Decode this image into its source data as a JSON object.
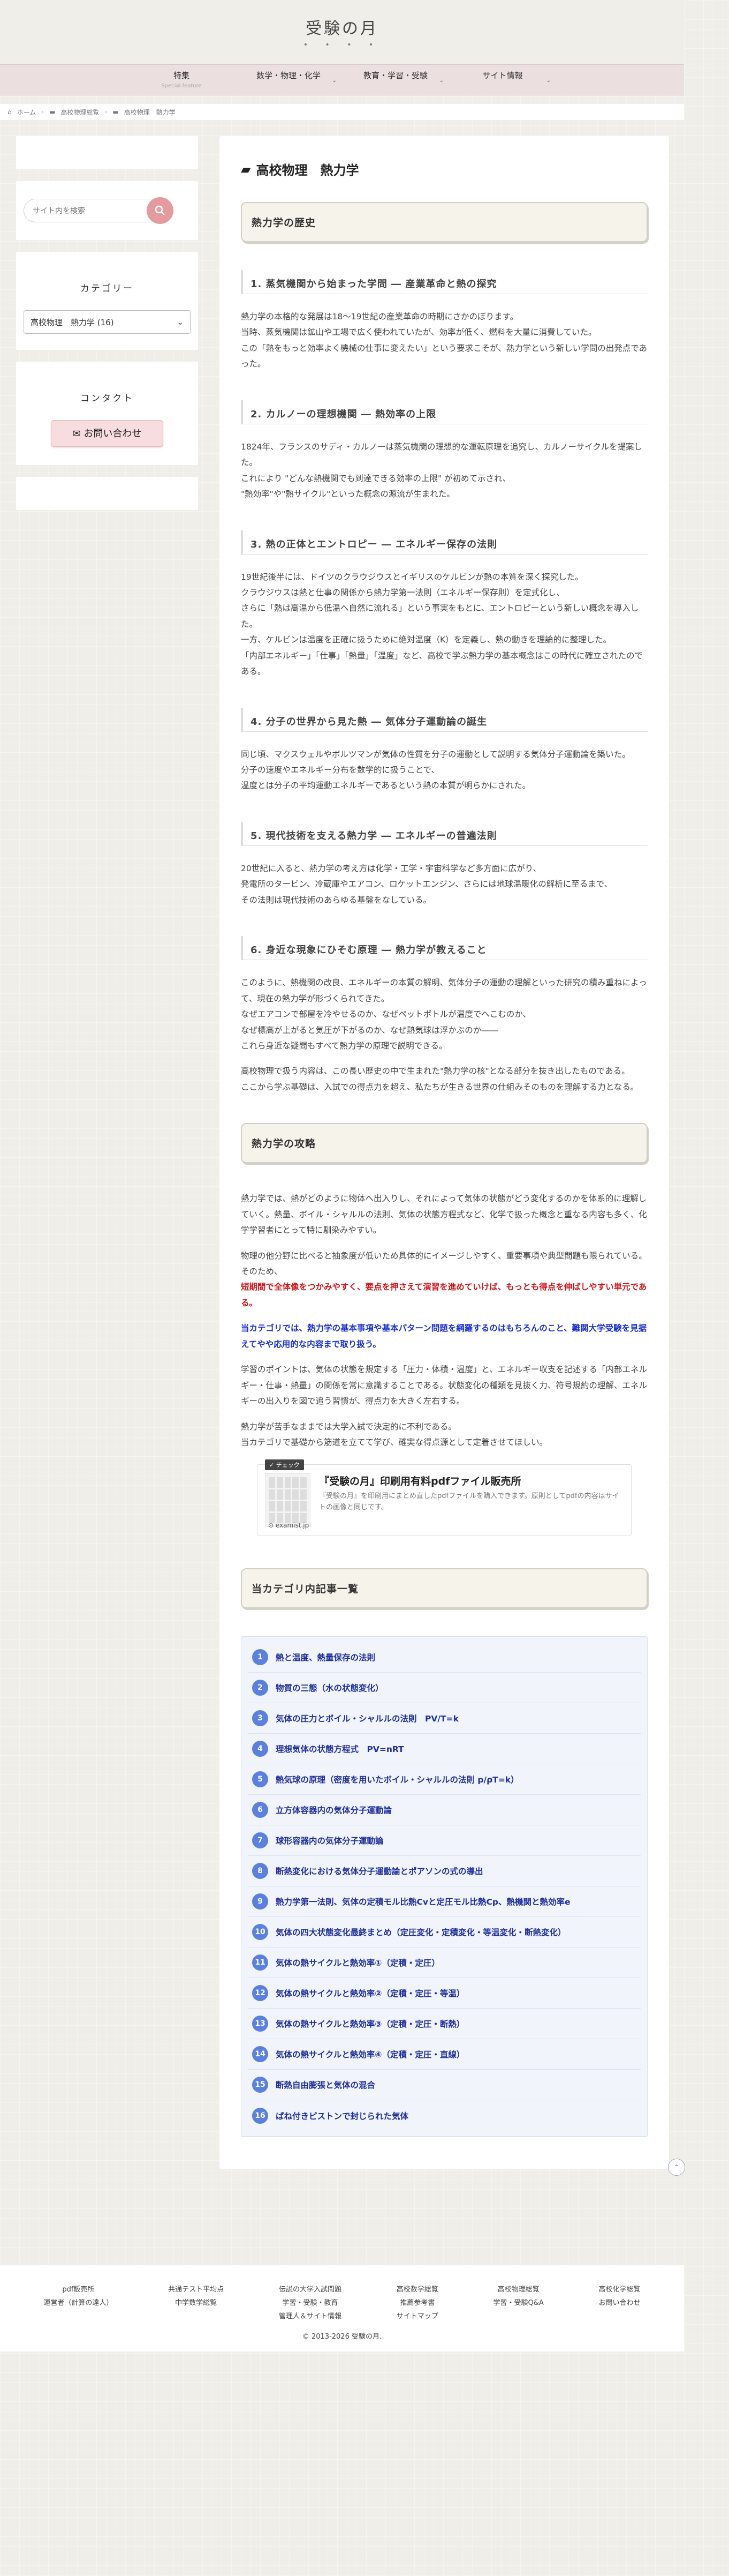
{
  "site": {
    "title": "受験の月",
    "dots": "• • • •"
  },
  "nav": [
    {
      "label": "特集",
      "sub": "Special feature",
      "caret": ""
    },
    {
      "label": "数学・物理・化学",
      "sub": "",
      "caret": "⌄"
    },
    {
      "label": "教育・学習・受験",
      "sub": "",
      "caret": "⌄"
    },
    {
      "label": "サイト情報",
      "sub": "",
      "caret": "⌄"
    }
  ],
  "breadcrumb": [
    "ホーム",
    "高校物理総覧",
    "高校物理　熱力学"
  ],
  "sidebar": {
    "search_placeholder": "サイト内を検索",
    "category_title": "カテゴリー",
    "category_value": "高校物理　熱力学 (16)",
    "contact_title": "コンタクト",
    "contact_button": "お問い合わせ"
  },
  "main": {
    "page_title": "高校物理　熱力学",
    "history_heading": "熱力学の歴史",
    "sections": [
      {
        "heading": "1. 蒸気機関から始まった学問 ― 産業革命と熱の探究",
        "paras": [
          "熱力学の本格的な発展は18～19世紀の産業革命の時期にさかのぼります。",
          "当時、蒸気機関は鉱山や工場で広く使われていたが、効率が低く、燃料を大量に消費していた。",
          "この「熱をもっと効率よく機械の仕事に変えたい」という要求こそが、熱力学という新しい学問の出発点であった。"
        ]
      },
      {
        "heading": "2. カルノーの理想機関 ― 熱効率の上限",
        "paras": [
          "1824年、フランスのサディ・カルノーは蒸気機関の理想的な運転原理を追究し、カルノーサイクルを提案した。",
          "これにより \"どんな熱機関でも到達できる効率の上限\" が初めて示され、",
          "\"熱効率\"や\"熱サイクル\"といった概念の源流が生まれた。"
        ]
      },
      {
        "heading": "3. 熱の正体とエントロピー ― エネルギー保存の法則",
        "paras": [
          "19世紀後半には、ドイツのクラウジウスとイギリスのケルビンが熱の本質を深く探究した。",
          "クラウジウスは熱と仕事の関係から熱力学第一法則（エネルギー保存則）を定式化し、",
          "さらに「熱は高温から低温へ自然に流れる」という事実をもとに、エントロピーという新しい概念を導入した。",
          "一方、ケルビンは温度を正確に扱うために絶対温度（K）を定義し、熱の動きを理論的に整理した。",
          "「内部エネルギー」「仕事」「熱量」「温度」など、高校で学ぶ熱力学の基本概念はこの時代に確立されたのである。"
        ]
      },
      {
        "heading": "4. 分子の世界から見た熱 ― 気体分子運動論の誕生",
        "paras": [
          "同じ頃、マクスウェルやボルツマンが気体の性質を分子の運動として説明する気体分子運動論を築いた。",
          "分子の速度やエネルギー分布を数学的に扱うことで、",
          "温度とは分子の平均運動エネルギーであるという熱の本質が明らかにされた。"
        ]
      },
      {
        "heading": "5. 現代技術を支える熱力学 ― エネルギーの普遍法則",
        "paras": [
          "20世紀に入ると、熱力学の考え方は化学・工学・宇宙科学など多方面に広がり、",
          "発電所のタービン、冷蔵庫やエアコン、ロケットエンジン、さらには地球温暖化の解析に至るまで、",
          "その法則は現代技術のあらゆる基盤をなしている。"
        ]
      },
      {
        "heading": "6. 身近な現象にひそむ原理 ― 熱力学が教えること",
        "paras": [
          "このように、熱機関の改良、エネルギーの本質の解明、気体分子の運動の理解といった研究の積み重ねによって、現在の熱力学が形づくられてきた。",
          "なぜエアコンで部屋を冷やせるのか、なぜペットボトルが温度でへこむのか、",
          "なぜ標高が上がると気圧が下がるのか、なぜ熱気球は浮かぶのか――",
          "これら身近な疑問もすべて熱力学の原理で説明できる。",
          "高校物理で扱う内容は、この長い歴史の中で生まれた\"熱力学の核\"となる部分を抜き出したものである。",
          "ここから学ぶ基礎は、入試での得点力を超え、私たちが生きる世界の仕組みそのものを理解する力となる。"
        ]
      }
    ],
    "strategy_heading": "熱力学の攻略",
    "strategy_paras": [
      "熱力学では、熱がどのように物体へ出入りし、それによって気体の状態がどう変化するのかを体系的に理解していく。熱量、ボイル・シャルルの法則、気体の状態方程式など、化学で扱った概念と重なる内容も多く、化学学習者にとって特に馴染みやすい。",
      "物理の他分野に比べると抽象度が低いため具体的にイメージしやすく、重要事項や典型問題も限られている。そのため、"
    ],
    "strategy_red": "短期間で全体像をつかみやすく、要点を押さえて演習を進めていけば、もっとも得点を伸ばしやすい単元である。",
    "strategy_blue": "当カテゴリでは、熱力学の基本事項や基本パターン問題を網羅するのはもちろんのこと、難関大学受験を見据えてやや応用的な内容まで取り扱う。",
    "strategy_paras2": [
      "学習のポイントは、気体の状態を規定する「圧力・体積・温度」と、エネルギー収支を記述する「内部エネルギー・仕事・熱量」の関係を常に意識することである。状態変化の種類を見抜く力、符号規約の理解、エネルギーの出入りを図で追う習慣が、得点力を大きく左右する。",
      "熱力学が苦手なままでは大学入試で決定的に不利である。",
      "当カテゴリで基礎から筋道を立てて学び、確実な得点源として定着させてほしい。"
    ],
    "card": {
      "tag": "✓ チェック",
      "title": "『受験の月』印刷用有料pdfファイル販売所",
      "desc": "『受験の月』を印刷用にまとめ直したpdfファイルを購入できます。原則としてpdfの内容はサイトの画像と同じです。",
      "site": "⊙ examist.jp"
    },
    "list_heading": "当カテゴリ内記事一覧",
    "articles": [
      {
        "n": "1",
        "t": "熱と温度、熱量保存の法則"
      },
      {
        "n": "2",
        "t": "物質の三態（水の状態変化）"
      },
      {
        "n": "3",
        "t": "気体の圧力とボイル・シャルルの法則　PV/T=k"
      },
      {
        "n": "4",
        "t": "理想気体の状態方程式　PV=nRT"
      },
      {
        "n": "5",
        "t": "熱気球の原理（密度を用いたボイル・シャルルの法則 p/ρT=k）"
      },
      {
        "n": "6",
        "t": "立方体容器内の気体分子運動論"
      },
      {
        "n": "7",
        "t": "球形容器内の気体分子運動論"
      },
      {
        "n": "8",
        "t": "断熱変化における気体分子運動論とポアソンの式の導出"
      },
      {
        "n": "9",
        "t": "熱力学第一法則、気体の定積モル比熱Cvと定圧モル比熱Cp、熱機関と熱効率e"
      },
      {
        "n": "10",
        "t": "気体の四大状態変化最終まとめ（定圧変化・定積変化・等温変化・断熱変化）"
      },
      {
        "n": "11",
        "t": "気体の熱サイクルと熱効率①（定積・定圧）"
      },
      {
        "n": "12",
        "t": "気体の熱サイクルと熱効率②（定積・定圧・等温）"
      },
      {
        "n": "13",
        "t": "気体の熱サイクルと熱効率③（定積・定圧・断熱）"
      },
      {
        "n": "14",
        "t": "気体の熱サイクルと熱効率④（定積・定圧・直線）"
      },
      {
        "n": "15",
        "t": "断熱自由膨張と気体の混合"
      },
      {
        "n": "16",
        "t": "ばね付きピストンで封じられた気体"
      }
    ]
  },
  "footer": {
    "cols": [
      [
        "pdf販売所",
        "運営者（計算の達人）"
      ],
      [
        "共通テスト平均点",
        "中学数学総覧"
      ],
      [
        "伝説の大学入試問題",
        "学習・受験・教育",
        "管理人＆サイト情報"
      ],
      [
        "高校数学総覧",
        "推薦参考書",
        "サイトマップ"
      ],
      [
        "高校物理総覧",
        "学習・受験Q&A"
      ],
      [
        "高校化学総覧",
        "お問い合わせ"
      ]
    ],
    "copyright": "© 2013-2026 受験の月."
  },
  "colors": {
    "accent_pink": "#e59a9e",
    "nav_bg": "#ecdfe0",
    "link_blue": "#1f2f9c",
    "num_blue": "#5a80e0",
    "red": "#d0141a"
  }
}
